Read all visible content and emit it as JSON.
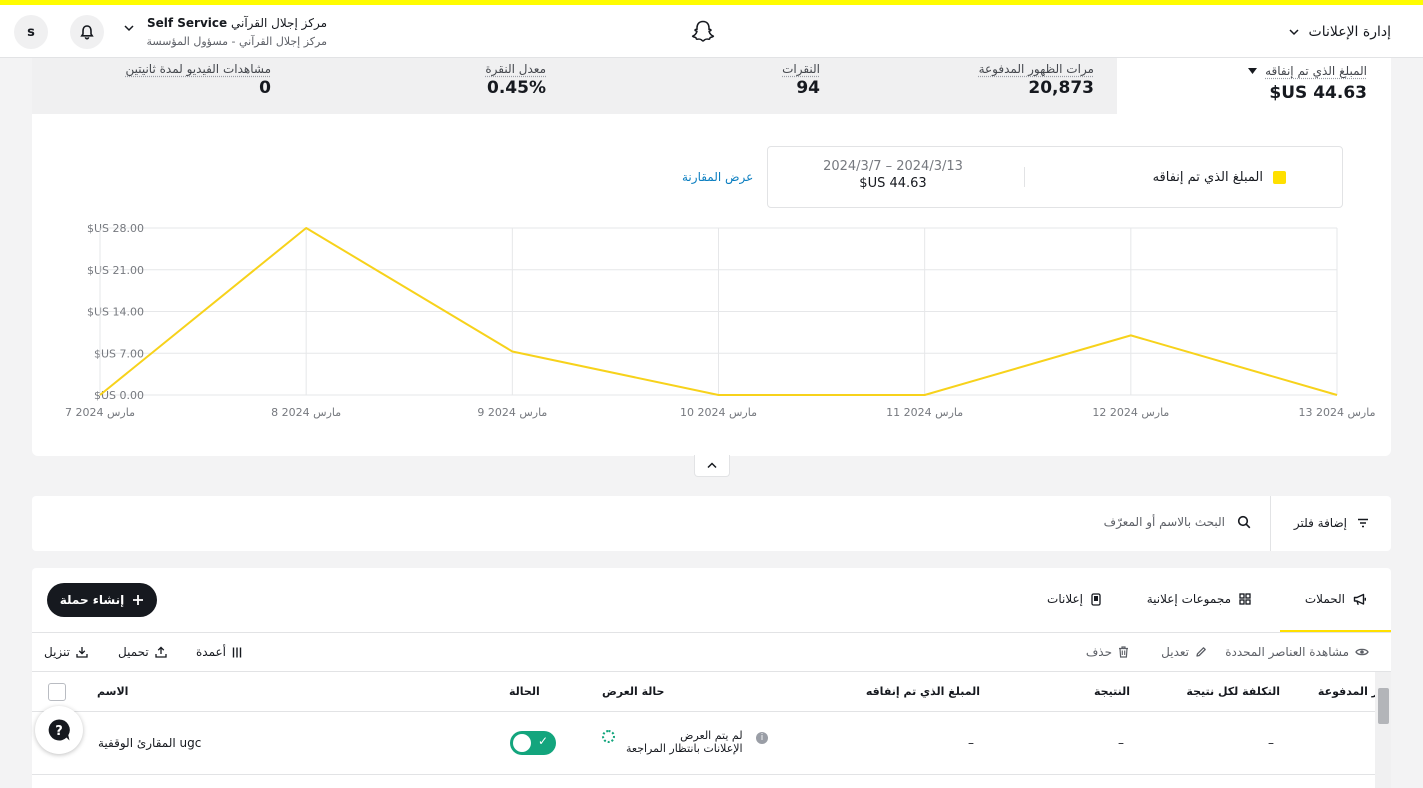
{
  "header": {
    "title": "إدارة الإعلانات",
    "org_name": "مركز إجلال القرآني",
    "org_tag": "Self Service",
    "org_subtitle": "مركز إجلال القرآني - مسؤول المؤسسة",
    "avatar_letter": "s"
  },
  "metrics": {
    "spend": {
      "label": "المبلغ الذي تم إنفاقه",
      "value": "$US 44.63"
    },
    "impressions": {
      "label": "مرات الظهور المدفوعة",
      "value": "20,873"
    },
    "swipes": {
      "label": "النقرات",
      "value": "94"
    },
    "swipe_rate": {
      "label": "معدل النقرة",
      "value": "0.45%"
    },
    "video_views": {
      "label": "مشاهدات الفيديو لمدة ثانيتين",
      "value": "0"
    }
  },
  "legend": {
    "series_label": "المبلغ الذي تم إنفاقه",
    "date_range": "2024/3/7 – 2024/3/13",
    "total": "$US 44.63",
    "compare_link": "عرض المقارنة"
  },
  "chart_data": {
    "type": "line",
    "x": [
      "7 مارس 2024",
      "8 مارس 2024",
      "9 مارس 2024",
      "10 مارس 2024",
      "11 مارس 2024",
      "12 مارس 2024",
      "13 مارس 2024"
    ],
    "y_ticks": [
      "$US 0.00",
      "$US 7.00",
      "$US 14.00",
      "$US 21.00",
      "$US 28.00"
    ],
    "ylim": [
      0,
      28
    ],
    "series": [
      {
        "name": "المبلغ الذي تم إنفاقه",
        "values": [
          0,
          28,
          7.3,
          0,
          0,
          10,
          0
        ],
        "color": "#f7d21b"
      }
    ],
    "grid": true
  },
  "filter": {
    "add_filter": "إضافة فلتر",
    "search_placeholder": "البحث بالاسم أو المعرّف"
  },
  "tabs": [
    {
      "label": "الحملات",
      "icon": "megaphone-icon",
      "active": true
    },
    {
      "label": "مجموعات إعلانية",
      "icon": "grid-icon",
      "active": false
    },
    {
      "label": "إعلانات",
      "icon": "phone-icon",
      "active": false
    }
  ],
  "create_button": "إنشاء حملة",
  "toolbar": {
    "view_selected": "مشاهدة العناصر المحددة",
    "edit": "تعديل",
    "delete": "حذف",
    "columns": "أعمدة",
    "upload": "تحميل",
    "download": "تنزيل"
  },
  "table": {
    "headers": {
      "name": "الاسم",
      "status": "الحالة",
      "delivery": "حالة العرض",
      "spend": "المبلغ الذي تم إنفاقه",
      "result": "النتيجة",
      "cost_per_result": "التكلفة لكل نتيجة",
      "paid": "ر المدفوعة"
    },
    "rows": [
      {
        "name": "المقارئ الوقفية ugc",
        "delivery_main": "لم يتم العرض",
        "delivery_sub": "الإعلانات بانتظار المراجعة",
        "spend": "–",
        "result": "–",
        "cost": "–",
        "status_on": true
      }
    ]
  },
  "colors": {
    "brand_yellow": "#fffc00",
    "line": "#f7d21b",
    "toggle_green": "#13a57d",
    "link_blue": "#0b7ec0"
  }
}
